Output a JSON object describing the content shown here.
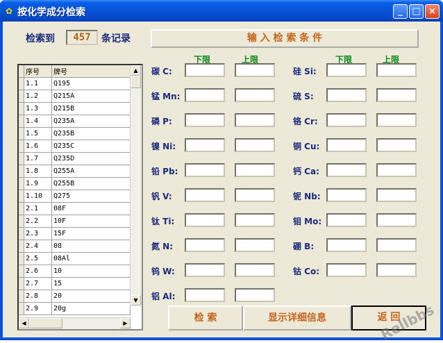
{
  "window": {
    "title": "按化学成分检索",
    "minimize": "_",
    "maximize": "□",
    "close": "×"
  },
  "summary": {
    "prefix": "检索到",
    "count": "457",
    "suffix": "条记录"
  },
  "banner_label": "输 入 检 索 条 件",
  "grid": {
    "headers": [
      "序号",
      "牌号"
    ],
    "rows": [
      [
        "1.1",
        "Q195"
      ],
      [
        "1.2",
        "Q215A"
      ],
      [
        "1.3",
        "Q215B"
      ],
      [
        "1.4",
        "Q235A"
      ],
      [
        "1.5",
        "Q235B"
      ],
      [
        "1.6",
        "Q235C"
      ],
      [
        "1.7",
        "Q235D"
      ],
      [
        "1.8",
        "Q255A"
      ],
      [
        "1.9",
        "Q255B"
      ],
      [
        "1.10",
        "Q275"
      ],
      [
        "2.1",
        "08F"
      ],
      [
        "2.2",
        "10F"
      ],
      [
        "2.3",
        "15F"
      ],
      [
        "2.4",
        "08"
      ],
      [
        "2.5",
        "08Al"
      ],
      [
        "2.6",
        "10"
      ],
      [
        "2.7",
        "15"
      ],
      [
        "2.8",
        "20"
      ],
      [
        "2.9",
        "20g"
      ]
    ]
  },
  "column_headers": {
    "lower": "下限",
    "upper": "上限"
  },
  "elements_left": [
    {
      "label": "碳 C:"
    },
    {
      "label": "锰 Mn:"
    },
    {
      "label": "磷 P:"
    },
    {
      "label": "镍 Ni:"
    },
    {
      "label": "铅 Pb:"
    },
    {
      "label": "钒 V:"
    },
    {
      "label": "钛 Ti:"
    },
    {
      "label": "氮 N:"
    },
    {
      "label": "钨 W:"
    },
    {
      "label": "铝 Al:"
    }
  ],
  "elements_right": [
    {
      "label": "硅 Si:"
    },
    {
      "label": "硫 S:"
    },
    {
      "label": "铬 Cr:"
    },
    {
      "label": "铜 Cu:"
    },
    {
      "label": "钙 Ca:"
    },
    {
      "label": "铌 Nb:"
    },
    {
      "label": "钼 Mo:"
    },
    {
      "label": "硼 B:"
    },
    {
      "label": "钴 Co:"
    }
  ],
  "buttons": {
    "search": "检 索",
    "details": "显示详细信息",
    "back": "返 回"
  },
  "watermark": "Rellbbs"
}
